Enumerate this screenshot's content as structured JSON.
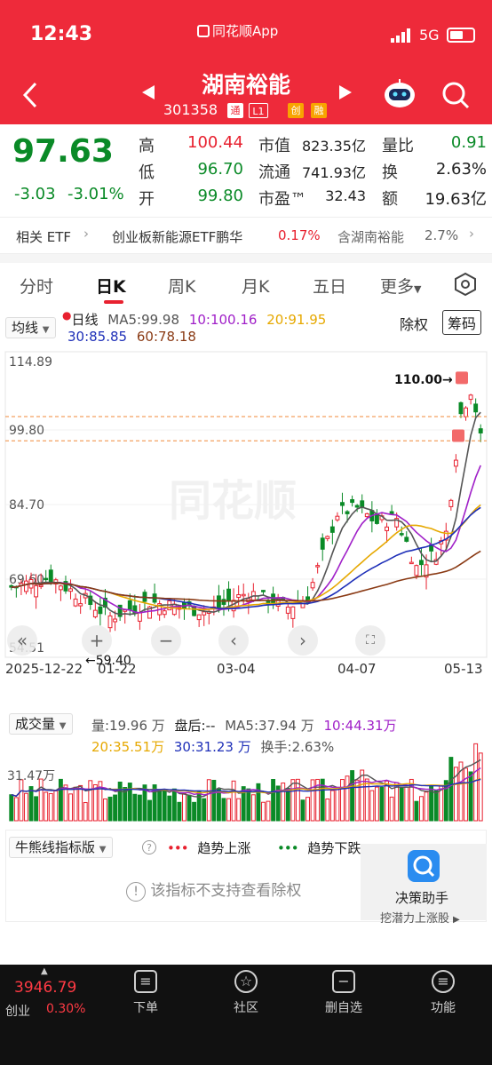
{
  "status_bar": {
    "time": "12:43",
    "app_name": "同花顺App",
    "network": "5G"
  },
  "header": {
    "stock_name": "湖南裕能",
    "stock_code": "301358",
    "tags": [
      "通",
      "L1",
      "创",
      "融"
    ]
  },
  "quote": {
    "price": "97.63",
    "change": "-3.03",
    "change_pct": "-3.01%",
    "high_label": "高",
    "high": "100.44",
    "low_label": "低",
    "low": "96.70",
    "open_label": "开",
    "open": "99.80",
    "mcap_label": "市值",
    "mcap": "823.35亿",
    "float_label": "流通",
    "float_cap": "741.93亿",
    "pe_label": "市盈™",
    "pe": "32.43",
    "vol_ratio_label": "量比",
    "vol_ratio": "0.91",
    "turnover_label": "换",
    "turnover": "2.63%",
    "amount_label": "额",
    "amount": "19.63亿"
  },
  "etf_bar": {
    "related_label": "相关 ETF",
    "etf_name": "创业板新能源ETF鹏华",
    "etf_pct": "0.17%",
    "contains_label": "含湖南裕能",
    "contains_pct": "2.7%"
  },
  "tabs": [
    "分时",
    "日K",
    "周K",
    "月K",
    "五日",
    "更多"
  ],
  "chart_header": {
    "ma_select": "均线",
    "kline_type": "日线",
    "ma5": "MA5:99.98",
    "ma10": "10:100.16",
    "ma20": "20:91.95",
    "ma30": "30:85.85",
    "ma60": "60:78.18",
    "adjust": "除权",
    "chips": "筹码"
  },
  "chart_data": {
    "type": "candlestick",
    "y_ticks": [
      "114.89",
      "99.80",
      "84.70",
      "69.60",
      "54.51"
    ],
    "ylim": [
      54.51,
      114.89
    ],
    "x_labels": [
      "2025-12-22",
      "01-22",
      "03-04",
      "04-07",
      "05-13"
    ],
    "annotation_high": "110.00",
    "annotation_low": "59.40",
    "watermark": "同花顺",
    "ma_colors": {
      "ma5": "#555555",
      "ma10": "#a020c8",
      "ma20": "#e6a800",
      "ma30": "#1e2fb8",
      "ma60": "#8a3a14"
    },
    "up_color": "#e8212f",
    "down_color": "#0a8a27"
  },
  "volume": {
    "select": "成交量",
    "vol": "量:19.96 万",
    "after_hours": "盘后:--",
    "ma5": "MA5:37.94 万",
    "ma10": "10:44.31万",
    "ma20": "20:35.51万",
    "ma30": "30:31.23 万",
    "turnover": "换手:2.63%",
    "y_tick": "31.47万"
  },
  "indicator": {
    "select": "牛熊线指标版",
    "help": "?",
    "up_legend": "趋势上涨",
    "down_legend": "趋势下跌",
    "unsupported": "该指标不支持查看除权",
    "assistant_title": "决策助手",
    "assistant_sub": "挖潜力上涨股"
  },
  "bottom_nav": {
    "index_value": "3946.79",
    "index_name": "创业",
    "index_pct": "0.30%",
    "items": [
      "下单",
      "社区",
      "删自选",
      "功能"
    ]
  }
}
